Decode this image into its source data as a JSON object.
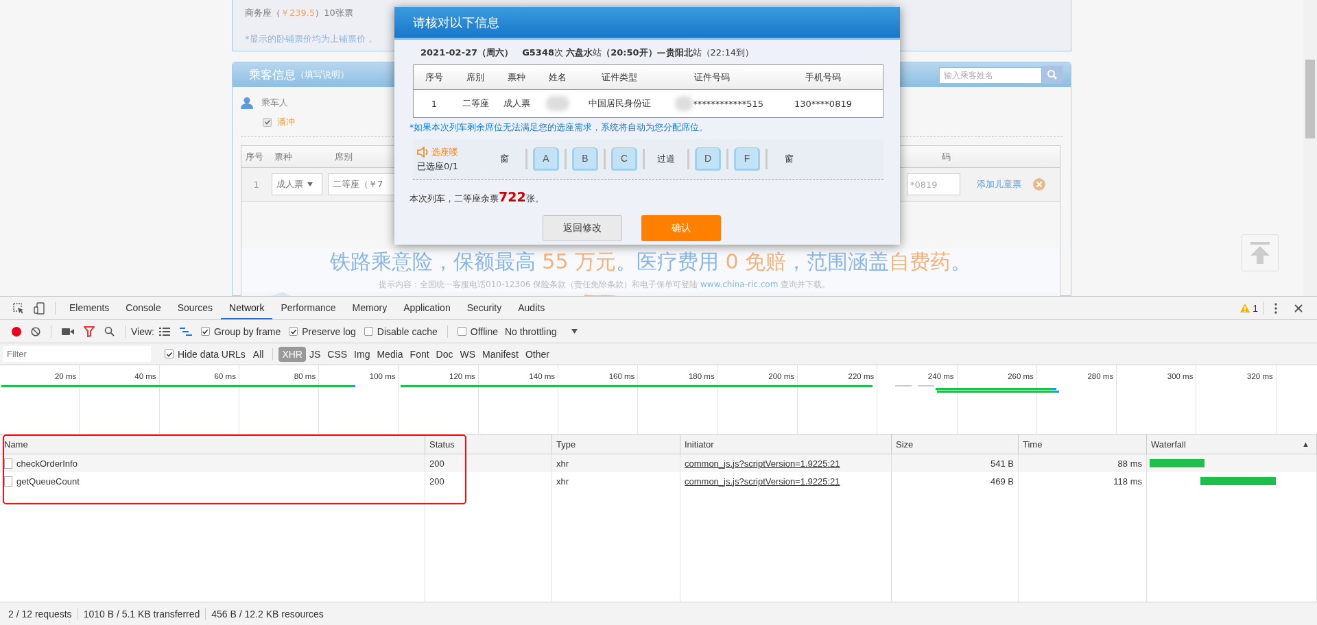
{
  "page": {
    "fare_box": {
      "fare": "商务座（**￥239.5**）10张票",
      "note": "*显示的卧铺票价均为上铺票价，"
    },
    "passenger_panel": {
      "title": "乘客信息",
      "title_hint": "（填写说明）",
      "search": {
        "placeholder": "输入乘客姓名"
      },
      "rider_label": "乘车人",
      "riders": [
        {
          "name": "潘冲",
          "checked": true
        }
      ],
      "table": {
        "columns": [
          "序号",
          "票种",
          "席别"
        ],
        "column_cut": "码",
        "rows": [
          {
            "index": "1",
            "ticket_type": "成人票",
            "seat_class": "二等座（￥7",
            "phone": "*0819",
            "add_child": "添加儿童票"
          }
        ]
      },
      "banner": {
        "headline": "铁路乘意险，保额最高 **55 万元**。医疗费用 **0 免赔**，范围涵盖**自费药**。",
        "hint": "提示内容：全国统一客服电话010-12306 保险条款（责任免除条款）和电子保单可登陆 ",
        "link": "www.china-ric.com",
        "hint_end": " 查询并下载。"
      }
    }
  },
  "dialog": {
    "title": "请核对以下信息",
    "trip": "**2021-02-27（周六）　G5348**次 **六盘水**站**（20:50开）—贵阳北**站（22:14到）",
    "columns": [
      "序号",
      "席别",
      "票种",
      "姓名",
      "证件类型",
      "证件号码",
      "手机号码"
    ],
    "rows": [
      {
        "index": "1",
        "seat_class": "二等座",
        "ticket_type": "成人票",
        "id_type": "中国居民身份证",
        "id_number": "************515",
        "phone": "130****0819"
      }
    ],
    "notice": "*如果本次列车剩余席位无法满足您的选座需求，系统将自动为您分配席位。",
    "seat_title": "选座喽",
    "seat_count": "已选座0/1",
    "seats": [
      {
        "kind": "label",
        "label": "窗"
      },
      {
        "kind": "seat",
        "label": "A",
        "selected": false
      },
      {
        "kind": "seat",
        "label": "B",
        "selected": false
      },
      {
        "kind": "seat",
        "label": "C",
        "selected": false
      },
      {
        "kind": "label",
        "label": "过道"
      },
      {
        "kind": "seat",
        "label": "D",
        "selected": false
      },
      {
        "kind": "seat",
        "label": "F",
        "selected": false
      },
      {
        "kind": "label",
        "label": "窗"
      }
    ],
    "remaining": "本次列车，二等座余票**722**张。",
    "buttons": [
      {
        "label": "返回修改",
        "kind": "secondary"
      },
      {
        "label": "确认",
        "kind": "primary"
      }
    ]
  },
  "devtools": {
    "tabs": [
      {
        "label": "Elements",
        "selected": false
      },
      {
        "label": "Console",
        "selected": false
      },
      {
        "label": "Sources",
        "selected": false
      },
      {
        "label": "Network",
        "selected": true
      },
      {
        "label": "Performance",
        "selected": false
      },
      {
        "label": "Memory",
        "selected": false
      },
      {
        "label": "Application",
        "selected": false
      },
      {
        "label": "Security",
        "selected": false
      },
      {
        "label": "Audits",
        "selected": false
      }
    ],
    "warnings": "1",
    "toolbar": {
      "recording": true,
      "view_label": "View:",
      "options": [
        {
          "label": "Group by frame",
          "checked": true
        },
        {
          "label": "Preserve log",
          "checked": true
        },
        {
          "label": "Disable cache",
          "checked": false
        },
        {
          "label": "Offline",
          "checked": false
        }
      ],
      "throttling": "No throttling"
    },
    "filter": {
      "placeholder": "Filter",
      "hide_data_urls": {
        "label": "Hide data URLs",
        "checked": true
      },
      "types": [
        {
          "label": "All",
          "selected": false
        },
        {
          "label": "XHR",
          "selected": true
        },
        {
          "label": "JS",
          "selected": false
        },
        {
          "label": "CSS",
          "selected": false
        },
        {
          "label": "Img",
          "selected": false
        },
        {
          "label": "Media",
          "selected": false
        },
        {
          "label": "Font",
          "selected": false
        },
        {
          "label": "Doc",
          "selected": false
        },
        {
          "label": "WS",
          "selected": false
        },
        {
          "label": "Manifest",
          "selected": false
        },
        {
          "label": "Other",
          "selected": false
        }
      ]
    },
    "overview": {
      "ticks": [
        "20 ms",
        "40 ms",
        "60 ms",
        "80 ms",
        "100 ms",
        "120 ms",
        "140 ms",
        "160 ms",
        "180 ms",
        "200 ms",
        "220 ms",
        "240 ms",
        "260 ms",
        "280 ms",
        "300 ms",
        "320 ms"
      ]
    },
    "table": {
      "columns": [
        "Name",
        "Status",
        "Type",
        "Initiator",
        "Size",
        "Time",
        "Waterfall"
      ],
      "sort_indicator": "▲",
      "rows": [
        {
          "name": "checkOrderInfo",
          "status": "200",
          "type": "xhr",
          "initiator": "common_js.js?scriptVersion=1.9225:21",
          "size": "541 B",
          "time": "88 ms"
        },
        {
          "name": "getQueueCount",
          "status": "200",
          "type": "xhr",
          "initiator": "common_js.js?scriptVersion=1.9225:21",
          "size": "469 B",
          "time": "118 ms"
        }
      ]
    },
    "status_bar": [
      "2 / 12 requests",
      "1010 B / 5.1 KB transferred",
      "456 B / 12.2 KB resources"
    ]
  }
}
